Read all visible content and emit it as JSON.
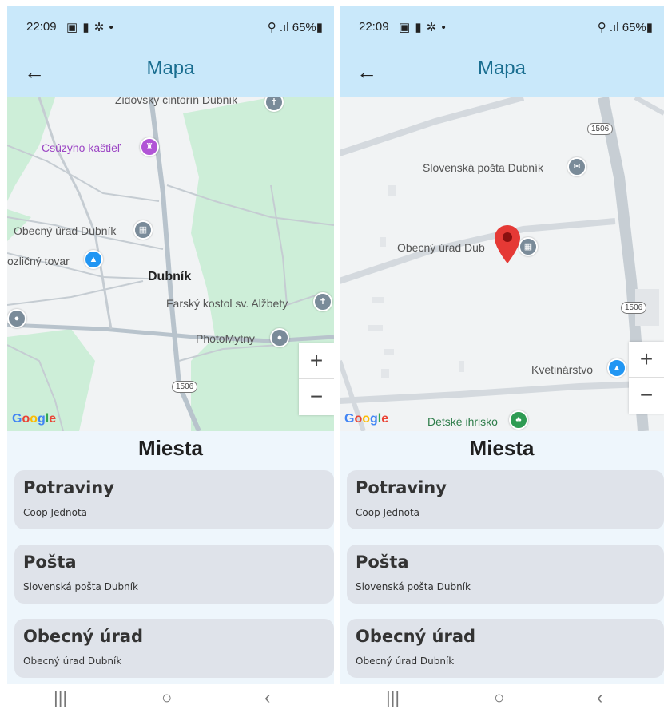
{
  "status_bar": {
    "time": "22:09",
    "icons": "▣ ▮ ✲ •",
    "battery": "⚲ .ıl 65%▮"
  },
  "app_bar": {
    "back_icon": "←",
    "title": "Mapa"
  },
  "map1": {
    "labels": [
      "Židovský cintorín Dubník",
      "Csúzyho kaštieľ",
      "Obecný úrad Dubník",
      "ozličný tovar",
      "Dubník",
      "Farský kostol sv. Alžbety",
      "PhotoMytny"
    ],
    "road_shield": "1506"
  },
  "map2": {
    "labels": [
      "Slovenská pošta Dubník",
      "Obecný úrad Dub",
      "Kvetinárstvo",
      "Detské ihrisko"
    ],
    "road_shields": [
      "1506",
      "1506"
    ]
  },
  "zoom": {
    "in": "+",
    "out": "−"
  },
  "google": [
    "G",
    "o",
    "o",
    "g",
    "l",
    "e"
  ],
  "section_title": "Miesta",
  "places": [
    {
      "category": "Potraviny",
      "name": "Coop Jednota"
    },
    {
      "category": "Pošta",
      "name": "Slovenská pošta Dubník"
    },
    {
      "category": "Obecný úrad",
      "name": "Obecný úrad Dubník"
    }
  ],
  "nav": {
    "recents": "|||",
    "home": "○",
    "back": "‹"
  },
  "colors": {
    "app_bar": "#c9e8fa",
    "title": "#1a6e90",
    "card": "#dfe3ea",
    "map_green": "#cdeed8",
    "map_bg": "#f1f3f4",
    "pin": "#e53935"
  }
}
